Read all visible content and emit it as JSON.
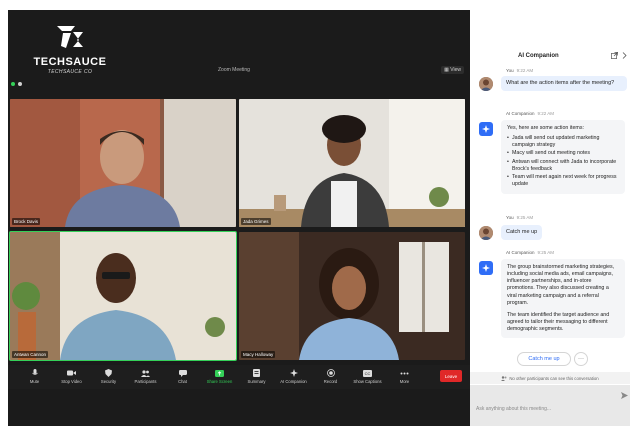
{
  "brand": {
    "name": "TECHSAUCE",
    "subtitle": "TECHSAUCE CO"
  },
  "meeting": {
    "title": "Zoom Meeting",
    "view_label": "View"
  },
  "participants": [
    {
      "name": "Brock Davis"
    },
    {
      "name": "Jada Grimes"
    },
    {
      "name": "Antwan Cannon"
    },
    {
      "name": "Macy Halloway"
    }
  ],
  "toolbar": {
    "items": [
      {
        "label": "Mute",
        "icon": "mic-icon"
      },
      {
        "label": "Stop Video",
        "icon": "video-icon"
      },
      {
        "label": "Security",
        "icon": "shield-icon"
      },
      {
        "label": "Participants",
        "icon": "people-icon"
      },
      {
        "label": "Chat",
        "icon": "chat-icon"
      },
      {
        "label": "Share Screen",
        "icon": "share-screen-icon"
      },
      {
        "label": "Summary",
        "icon": "summary-icon"
      },
      {
        "label": "AI Companion",
        "icon": "sparkle-icon"
      },
      {
        "label": "Record",
        "icon": "record-icon"
      },
      {
        "label": "Show Captions",
        "icon": "captions-icon"
      },
      {
        "label": "More",
        "icon": "more-icon"
      }
    ],
    "leave_label": "Leave"
  },
  "panel": {
    "title": "AI Companion",
    "messages": [
      {
        "sender": "You",
        "time": "9:22 AM",
        "text": "What are the action items after the meeting?"
      },
      {
        "sender": "AI Companion",
        "time": "9:22 AM",
        "intro": "Yes, here are some action items:",
        "items": [
          "Jada will send out updated marketing campaign strategy",
          "Macy will send out meeting notes",
          "Antwan will connect with Jada to incorporate Brock's feedback",
          "Team will meet again next week for progress update"
        ]
      },
      {
        "sender": "You",
        "time": "9:25 AM",
        "text": "Catch me up"
      },
      {
        "sender": "AI Companion",
        "time": "9:25 AM",
        "para1": "The group brainstormed marketing strategies, including social media ads, email campaigns, influencer partnerships, and in-store promotions. They also discussed creating a viral marketing campaign and a referral program.",
        "para2": "The team identified the target audience and agreed to tailor their messaging to different demographic segments."
      }
    ],
    "catch_up_label": "Catch me up",
    "more_label": "···",
    "notice": "No other participants can see this conversation",
    "input_placeholder": "Ask anything about this meeting..."
  },
  "colors": {
    "accent": "#2f6df6",
    "active_speaker": "#34d058",
    "leave": "#e02828"
  }
}
